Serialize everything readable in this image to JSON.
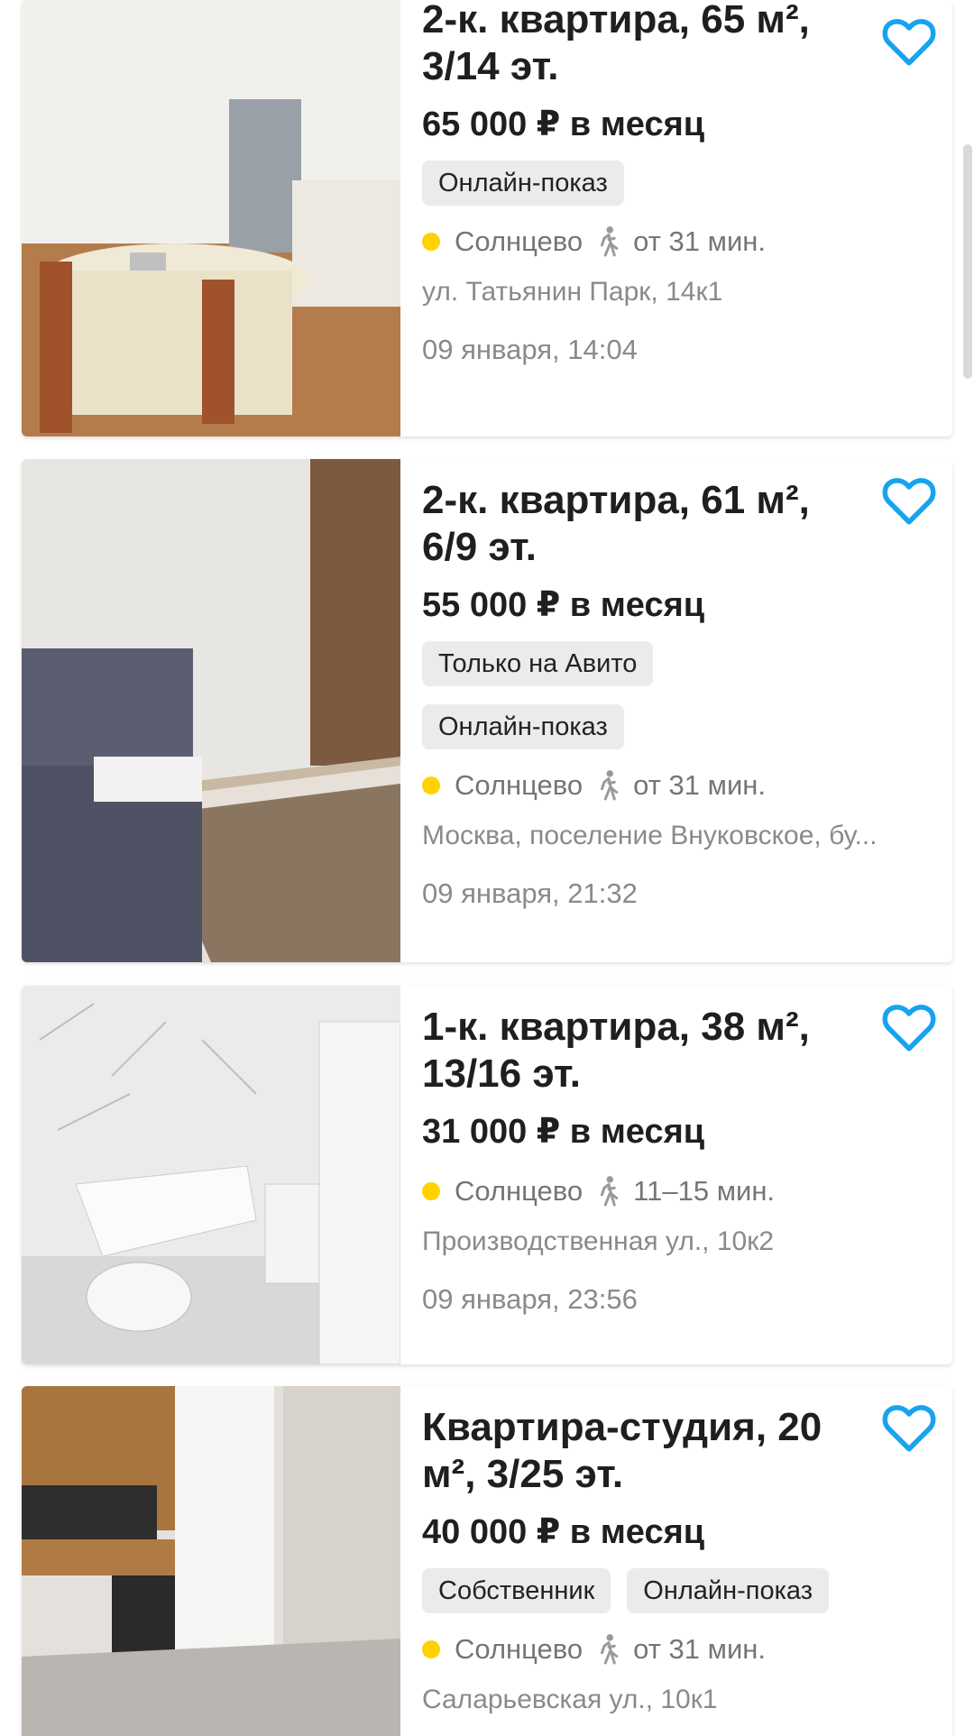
{
  "listings": [
    {
      "title": "2-к. квартира, 65 м², 3/14 эт.",
      "price": "65 000 ₽ в месяц",
      "badges": [
        "Онлайн-показ"
      ],
      "metro": "Солнцево",
      "walk": "от 31 мин.",
      "address": "ул. Татьянин Парк, 14к1",
      "date": "09 января, 14:04"
    },
    {
      "title": "2-к. квартира, 61 м², 6/9 эт.",
      "price": "55 000 ₽ в месяц",
      "badges": [
        "Только на Авито",
        "Онлайн-показ"
      ],
      "metro": "Солнцево",
      "walk": "от 31 мин.",
      "address": "Москва, поселение Внуковское, бу...",
      "date": "09 января, 21:32"
    },
    {
      "title": "1-к. квартира, 38 м², 13/16 эт.",
      "price": "31 000 ₽ в месяц",
      "badges": [],
      "metro": "Солнцево",
      "walk": "11–15 мин.",
      "address": "Производственная ул., 10к2",
      "date": "09 января, 23:56"
    },
    {
      "title": "Квартира-студия, 20 м², 3/25 эт.",
      "price": "40 000 ₽ в месяц",
      "badges": [
        "Собственник",
        "Онлайн-показ"
      ],
      "metro": "Солнцево",
      "walk": "от 31 мин.",
      "address": "Саларьевская ул., 10к1",
      "date": ""
    }
  ],
  "colors": {
    "favorite": "#17a3f0",
    "metro_line": "#ffd200",
    "badge_bg": "#ebebeb"
  },
  "icons": {
    "favorite": "heart-outline-icon",
    "walk": "pedestrian-icon",
    "metro": "metro-line-dot-icon"
  }
}
